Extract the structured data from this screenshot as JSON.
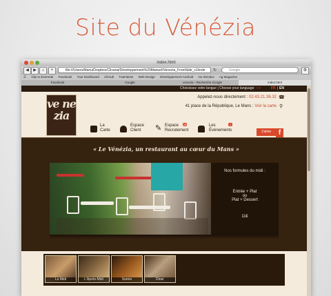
{
  "showcase_title": "Site du Vénézia",
  "browser": {
    "window_title": "index.html",
    "url": "file:///Users/Manu/Dropbox/Clivana/Développement%20Manuel/Venezia_FrontSide_v1/inde",
    "search_placeholder": "Google",
    "bookmarks": [
      "Clip to Evernote",
      "Facebook",
      "Your Dashboard",
      "Climub",
      "Tuterlasse",
      "Web Design",
      "Développement Android",
      "Aw Introduc",
      "ng Magazine"
    ],
    "tabs": [
      "Facebook",
      "Google",
      "venezia - Recherche Google",
      "index.html"
    ],
    "active_tab": 3
  },
  "site": {
    "language_prompt": "Choisissez votre langue | Choose your language",
    "lang_fr": "FR",
    "lang_sep": "|",
    "lang_en": "EN",
    "logo_text": "ve ne zia",
    "phone_label": "Appelez-nous directement :",
    "phone_number": "02.43.21.36.32",
    "address": "41 place de la République, Le Mans :",
    "map_link": "Voir la carte",
    "menu": [
      {
        "line1": "La",
        "line2": "Carte",
        "icon": "fork-icon"
      },
      {
        "line1": "Espace",
        "line2": "Client",
        "icon": "user-icon"
      },
      {
        "line1": "Espace",
        "line2": "Recrutement",
        "icon": "pen-icon",
        "badge": "26"
      },
      {
        "line1": "Les",
        "line2": "Évènements",
        "icon": "cake-icon",
        "badge": "1"
      }
    ],
    "jaime": "J'aime",
    "facebook_letter": "f",
    "tagline": "« Le Vénézia, un restaurant au cœur du Mans »",
    "formulas": {
      "title": "Nos formules du midi :",
      "option1": "Entrée + Plat",
      "or": "ou",
      "option2": "Plat + Dessert",
      "price": "11€"
    },
    "thumbnails": [
      "Le Midi",
      "L'Après-Midi",
      "Soirée",
      "Diner"
    ]
  },
  "colors": {
    "accent": "#d75a3a",
    "dark_brown": "#35220f",
    "cream": "#f4ebdd",
    "teal": "#27a7a6"
  }
}
